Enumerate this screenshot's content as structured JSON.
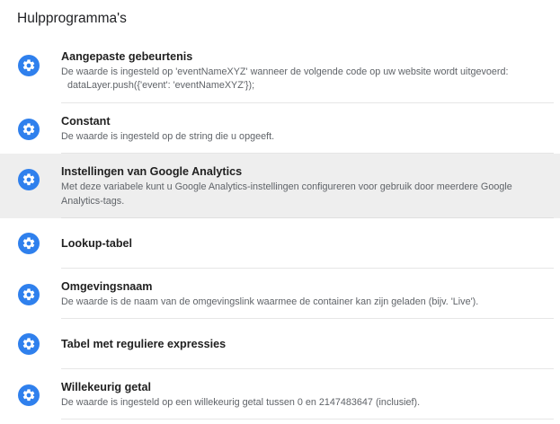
{
  "section": {
    "title": "Hulpprogramma's"
  },
  "colors": {
    "accent": "#2f80ed",
    "selected_background": "#eeeeee"
  },
  "icon_name": "gear-icon",
  "items": [
    {
      "name": "Aangepaste gebeurtenis",
      "description": "De waarde is ingesteld op 'eventNameXYZ' wanneer de volgende code op uw website wordt uitgevoerd:",
      "code": "dataLayer.push({'event': 'eventNameXYZ'});"
    },
    {
      "name": "Constant",
      "description": "De waarde is ingesteld op de string die u opgeeft."
    },
    {
      "name": "Instellingen van Google Analytics",
      "description": "Met deze variabele kunt u Google Analytics-instellingen configureren voor gebruik door meerdere Google Analytics-tags.",
      "selected": true
    },
    {
      "name": "Lookup-tabel"
    },
    {
      "name": "Omgevingsnaam",
      "description": "De waarde is de naam van de omgevingslink waarmee de container kan zijn geladen (bijv. 'Live')."
    },
    {
      "name": "Tabel met reguliere expressies"
    },
    {
      "name": "Willekeurig getal",
      "description": "De waarde is ingesteld op een willekeurig getal tussen 0 en 2147483647 (inclusief)."
    }
  ]
}
